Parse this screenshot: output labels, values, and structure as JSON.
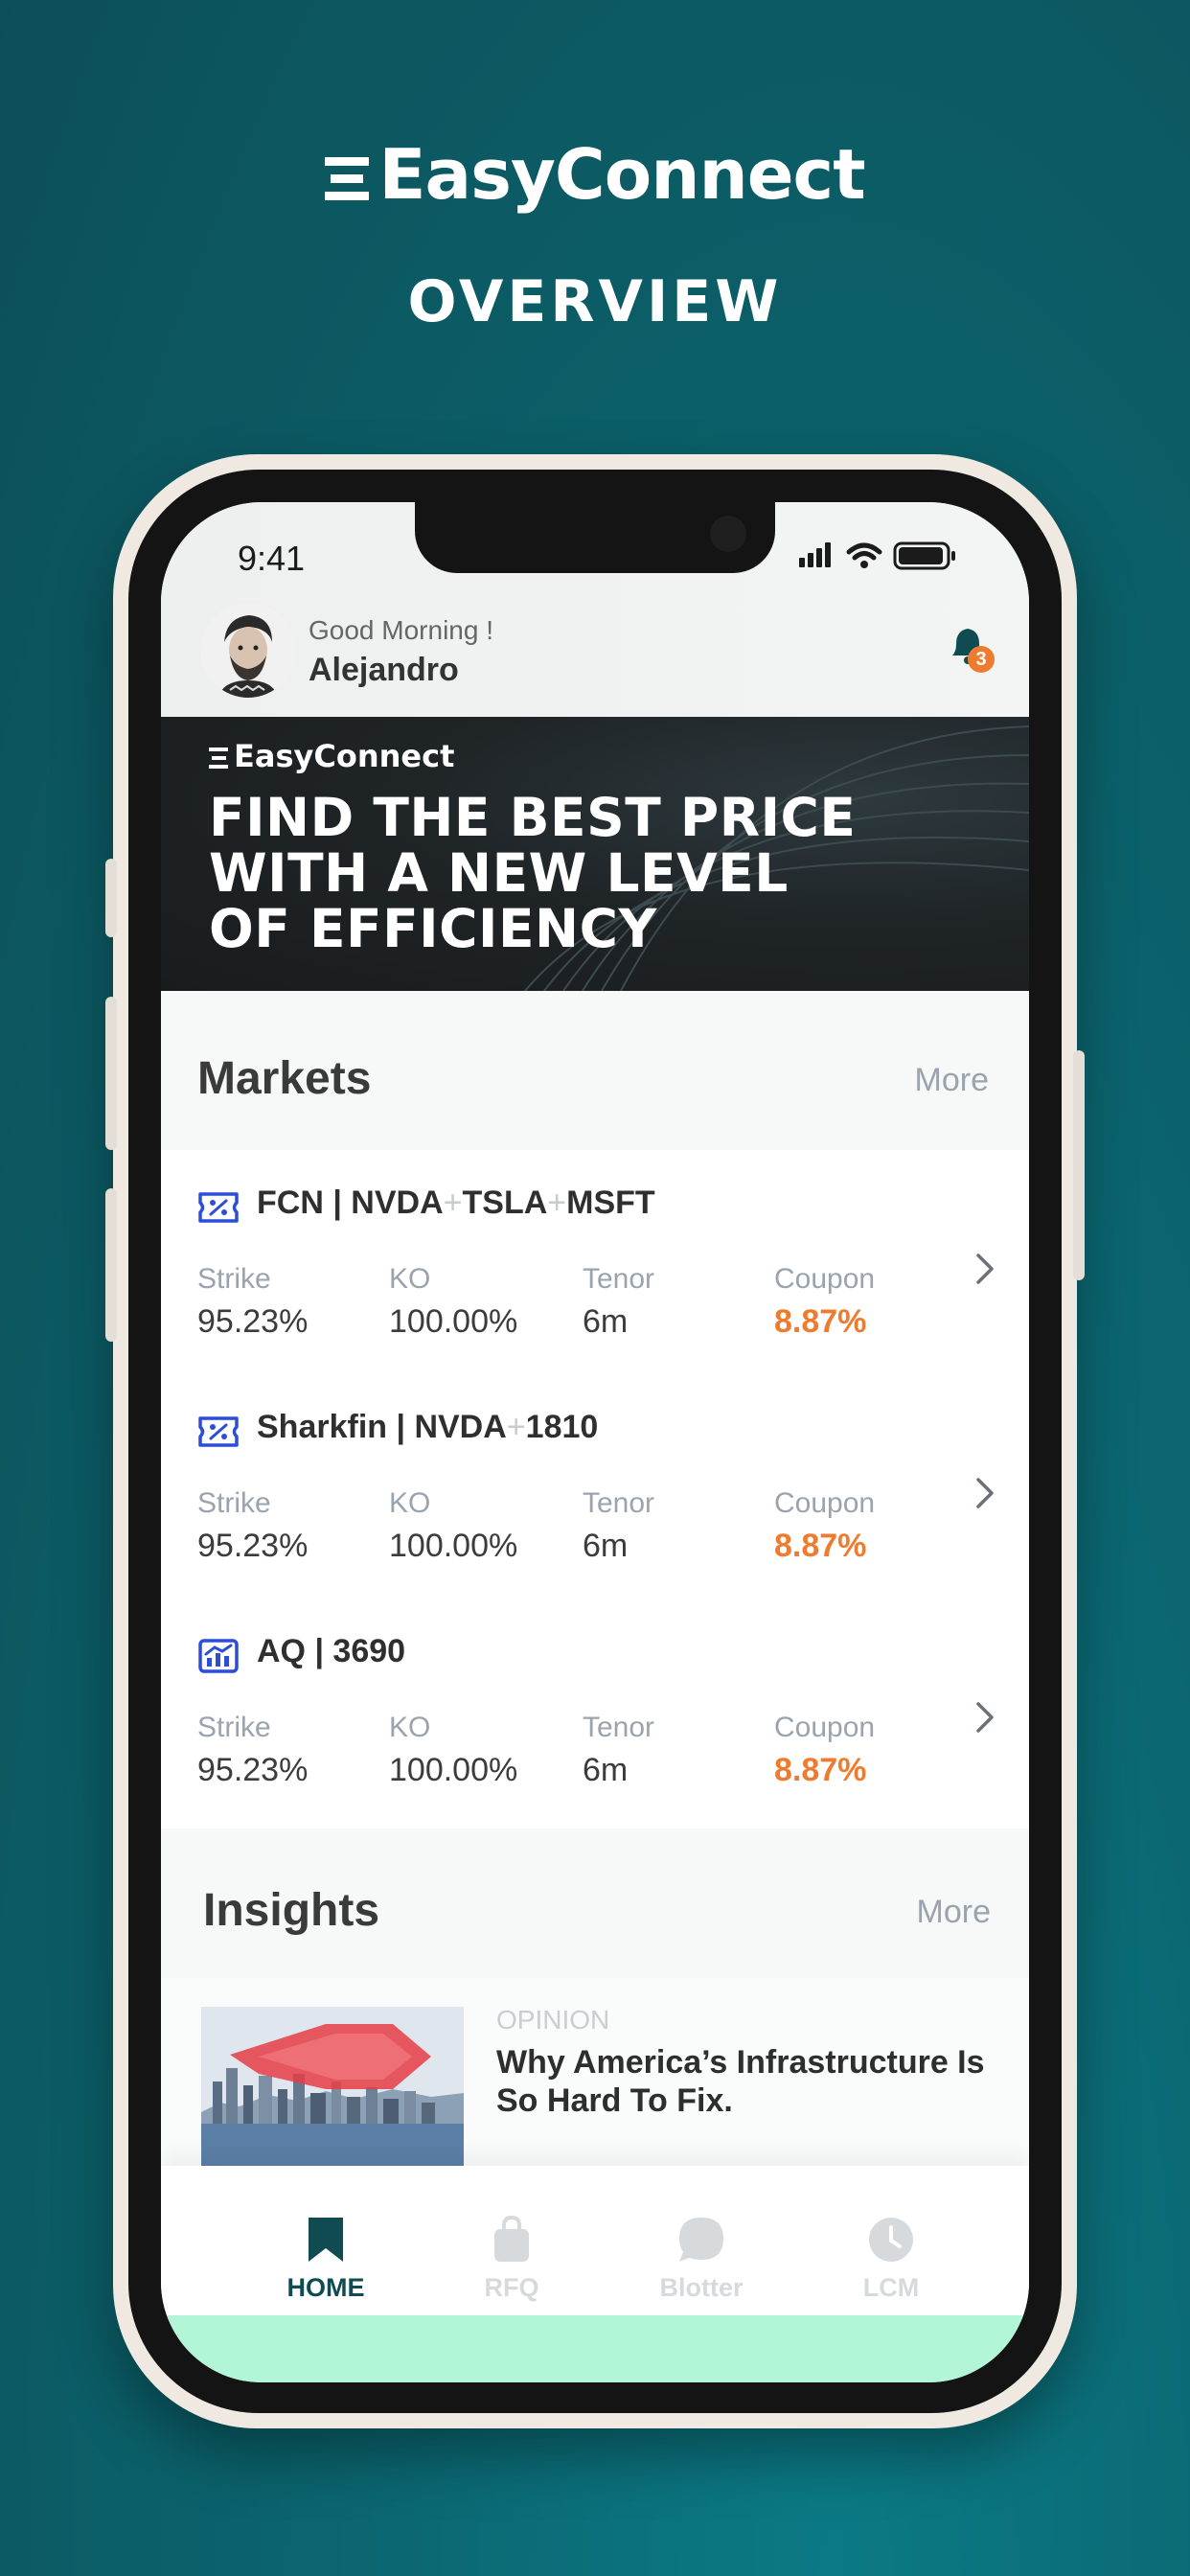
{
  "promo": {
    "brand": "EasyConnect",
    "heading": "OVERVIEW"
  },
  "status_bar": {
    "time": "9:41"
  },
  "header": {
    "greeting": "Good Morning !",
    "user_name": "Alejandro",
    "notification_count": "3"
  },
  "banner": {
    "brand": "EasyConnect",
    "title_lines": [
      "FIND THE BEST PRICE",
      "WITH A NEW LEVEL",
      "OF EFFICIENCY"
    ]
  },
  "markets": {
    "title": "Markets",
    "more": "More",
    "items": [
      {
        "icon": "percent-ticket-icon",
        "type": "FCN",
        "sep": " | ",
        "underlyings": [
          "NVDA",
          "TSLA",
          "MSFT"
        ],
        "stats": [
          {
            "label": "Strike",
            "value": "95.23%"
          },
          {
            "label": "KO",
            "value": "100.00%"
          },
          {
            "label": "Tenor",
            "value": "6m"
          },
          {
            "label": "Coupon",
            "value": "8.87%"
          }
        ]
      },
      {
        "icon": "percent-ticket-icon",
        "type": "Sharkfin",
        "sep": " | ",
        "underlyings": [
          "NVDA",
          "1810"
        ],
        "stats": [
          {
            "label": "Strike",
            "value": "95.23%"
          },
          {
            "label": "KO",
            "value": "100.00%"
          },
          {
            "label": "Tenor",
            "value": "6m"
          },
          {
            "label": "Coupon",
            "value": "8.87%"
          }
        ]
      },
      {
        "icon": "bar-chart-icon",
        "type": "AQ",
        "sep": " | ",
        "underlyings": [
          "3690"
        ],
        "stats": [
          {
            "label": "Strike",
            "value": "95.23%"
          },
          {
            "label": "KO",
            "value": "100.00%"
          },
          {
            "label": "Tenor",
            "value": "6m"
          },
          {
            "label": "Coupon",
            "value": "8.87%"
          }
        ]
      }
    ]
  },
  "insights": {
    "title": "Insights",
    "more": "More",
    "article": {
      "tag": "OPINION",
      "title": "Why America’s Infrastructure Is So Hard To Fix."
    }
  },
  "tabbar": {
    "tabs": [
      {
        "label": "HOME",
        "icon": "bookmark-icon",
        "color": "#0f4b50"
      },
      {
        "label": "RFQ",
        "icon": "bag-icon",
        "color": "#d6dadd"
      },
      {
        "label": "Blotter",
        "icon": "chat-icon",
        "color": "#d6dadd"
      },
      {
        "label": "LCM",
        "icon": "clock-icon",
        "color": "#d6dadd"
      }
    ]
  },
  "colors": {
    "accent_teal": "#0f4b50",
    "coupon_orange": "#ef7b2f",
    "badge_orange": "#ef7b2f"
  }
}
